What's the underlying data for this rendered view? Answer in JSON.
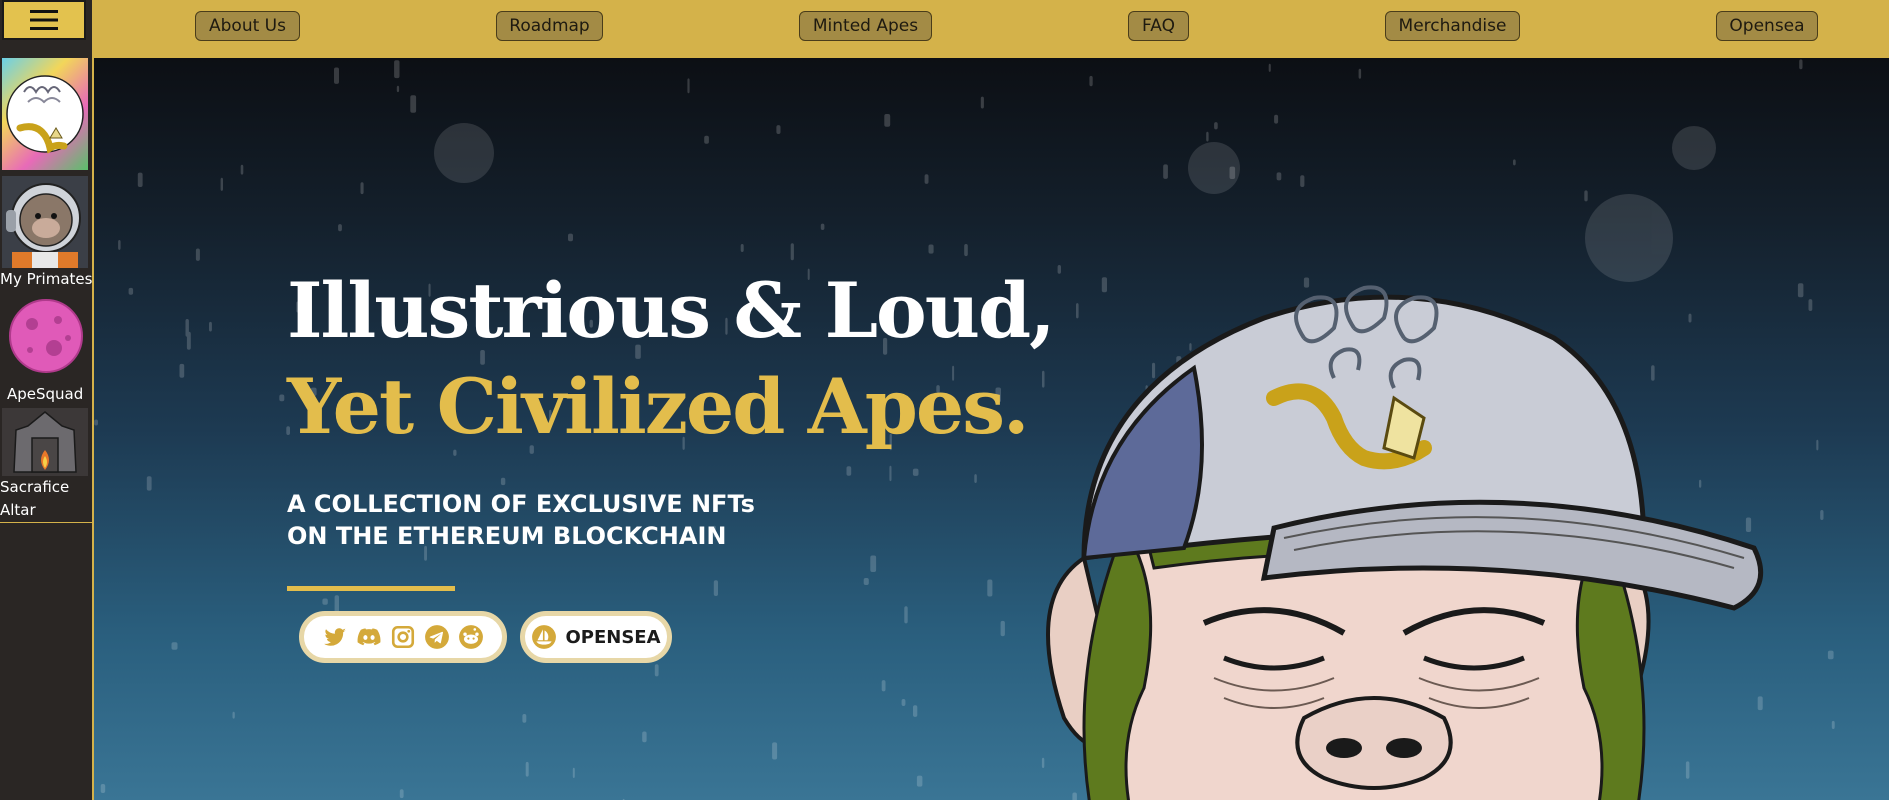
{
  "nav": {
    "items": [
      {
        "label": "About Us"
      },
      {
        "label": "Roadmap"
      },
      {
        "label": "Minted Apes"
      },
      {
        "label": "FAQ"
      },
      {
        "label": "Merchandise"
      },
      {
        "label": "Opensea"
      }
    ]
  },
  "sidebar": {
    "menu_icon": "hamburger-icon",
    "items": [
      {
        "label": "",
        "icon": "logo-banana-pipe"
      },
      {
        "label": "My Primates",
        "icon": "astronaut-ape"
      },
      {
        "label": "ApeSquad",
        "icon": "pink-planet"
      },
      {
        "label": "Sacrafice Altar",
        "label_line1": "Sacrafice",
        "label_line2": "Altar",
        "icon": "altar"
      }
    ]
  },
  "hero": {
    "title_line1": "Illustrious & Loud,",
    "title_line2": "Yet Civilized Apes.",
    "subtitle_line1": "A COLLECTION OF EXCLUSIVE NFTs",
    "subtitle_line2": "ON THE ETHEREUM BLOCKCHAIN",
    "social_icons": [
      "twitter-icon",
      "discord-icon",
      "instagram-icon",
      "telegram-icon",
      "reddit-icon"
    ],
    "opensea_label": "OPENSEA"
  },
  "colors": {
    "accent_gold": "#d4b24a",
    "title_gold": "#e3bd4c",
    "nav_button": "#a38b45",
    "sidebar_bg": "#2a2624"
  }
}
